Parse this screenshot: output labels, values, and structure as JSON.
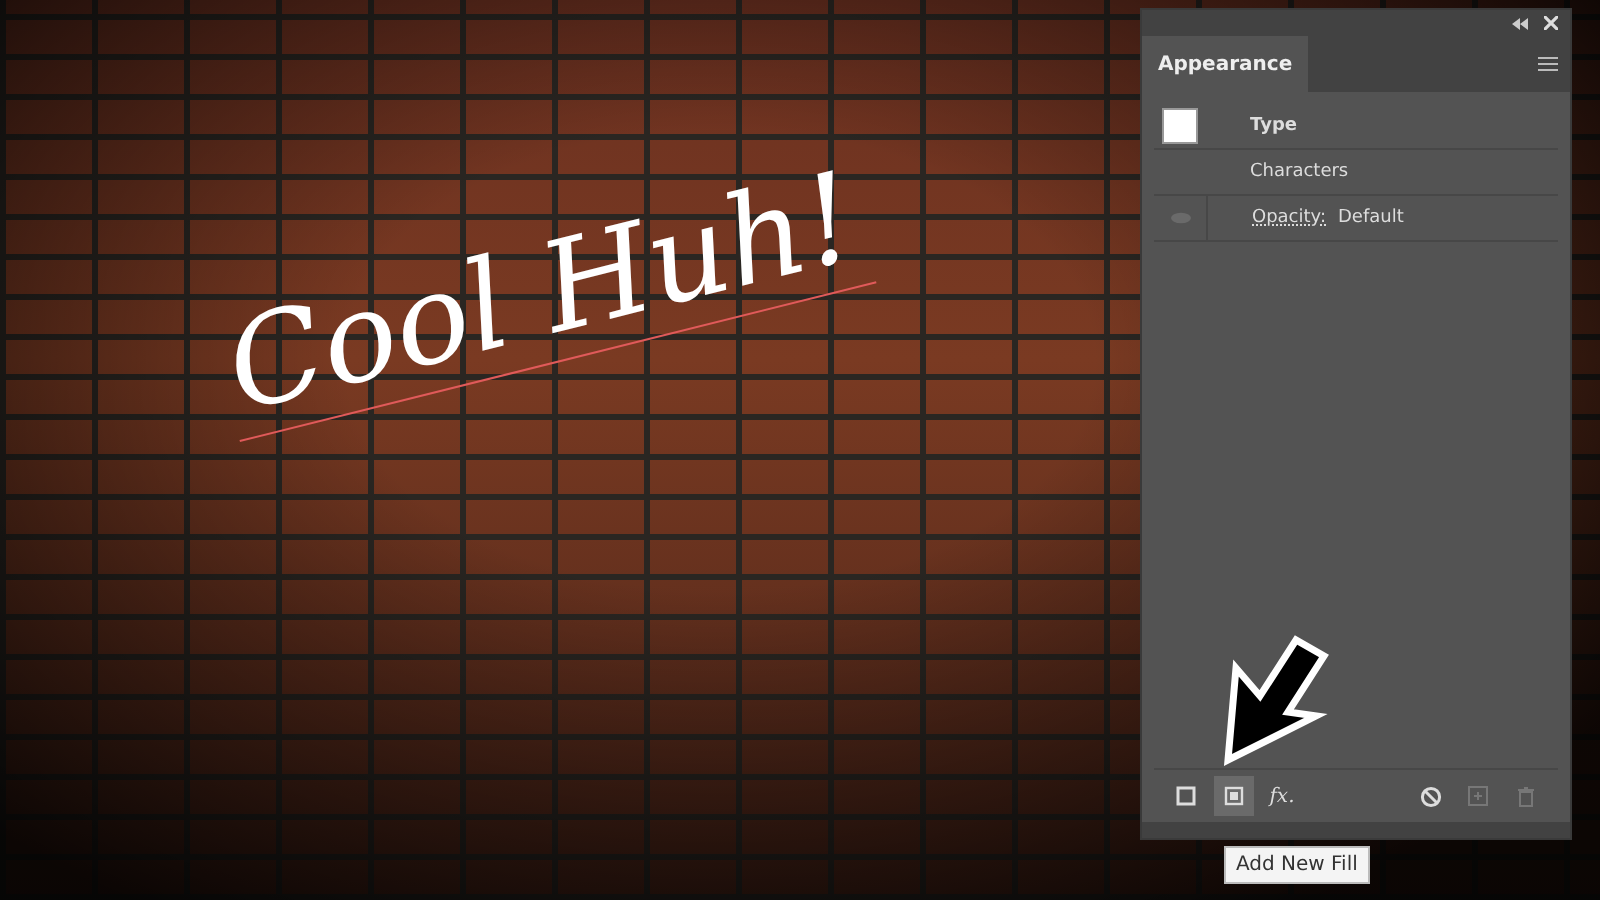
{
  "canvas": {
    "text": "Cool Huh!"
  },
  "panel": {
    "title": "Appearance",
    "rows": [
      {
        "kind": "swatch",
        "label": "Type"
      },
      {
        "kind": "plain",
        "label": "Characters"
      },
      {
        "kind": "attribute",
        "label": "Opacity:",
        "value": "Default"
      }
    ],
    "footer_buttons": [
      {
        "kind": "stroke",
        "selected": false,
        "disabled": false
      },
      {
        "kind": "fill",
        "selected": true,
        "disabled": false
      },
      {
        "kind": "fx",
        "label": "fx.",
        "selected": false,
        "disabled": false
      },
      {
        "kind": "clear",
        "selected": false,
        "disabled": false
      },
      {
        "kind": "duplicate",
        "selected": false,
        "disabled": true
      },
      {
        "kind": "delete",
        "selected": false,
        "disabled": true
      }
    ]
  },
  "tooltip": "Add New Fill"
}
